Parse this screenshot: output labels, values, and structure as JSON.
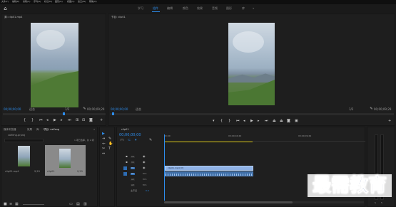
{
  "menubar": {
    "items": [
      "文件(F)",
      "编辑(E)",
      "剪辑(C)",
      "序列(S)",
      "标记(M)",
      "图形(G)",
      "视图(V)",
      "窗口(W)",
      "帮助(H)"
    ]
  },
  "workspaces": {
    "tabs": [
      "学习",
      "组件",
      "编辑",
      "颜色",
      "效果",
      "音频",
      "图形",
      "库"
    ],
    "active": "组件",
    "overflow": "»"
  },
  "source_monitor": {
    "title": "源: clip01.mp4",
    "timecode": "00;00;00;00",
    "fit_label": "适合",
    "scale": "1/2",
    "duration": "00;00;09;29"
  },
  "program_monitor": {
    "title": "节目: clip01",
    "timecode": "00;00;00;00",
    "fit_label": "适合",
    "scale": "1/2",
    "duration": "00;00;09;29"
  },
  "project_panel": {
    "tabs": [
      "媒体浏览器",
      "效果",
      "库",
      "项目: caifeng"
    ],
    "active_tab": "项目: caifeng",
    "overflow": "»",
    "path": "caifeng.prproj",
    "search_placeholder": "",
    "items_count": "1 项已选择，共 2 项",
    "items": [
      {
        "name": "clip01.mp4",
        "duration": "9;29"
      },
      {
        "name": "clip01",
        "duration": "9;29"
      }
    ]
  },
  "timeline": {
    "tab": "clip01",
    "timecode": "00;00;00;00",
    "ruler": [
      "00;00",
      "00;00;04;29",
      "00;00;09;29"
    ],
    "video_tracks": [
      "V3",
      "V2",
      "V1"
    ],
    "audio_tracks": [
      "A1",
      "A2",
      "A3"
    ],
    "master_label": "主声道",
    "master_value": "0.0",
    "clip_label": "clip01.mp4 [V]"
  },
  "watermark": {
    "text": "最需教育"
  },
  "colors": {
    "accent": "#2d8ceb",
    "clip_video": "#8fb2e6",
    "clip_audio": "#3f6fa8",
    "bg": "#1c1c1c"
  }
}
